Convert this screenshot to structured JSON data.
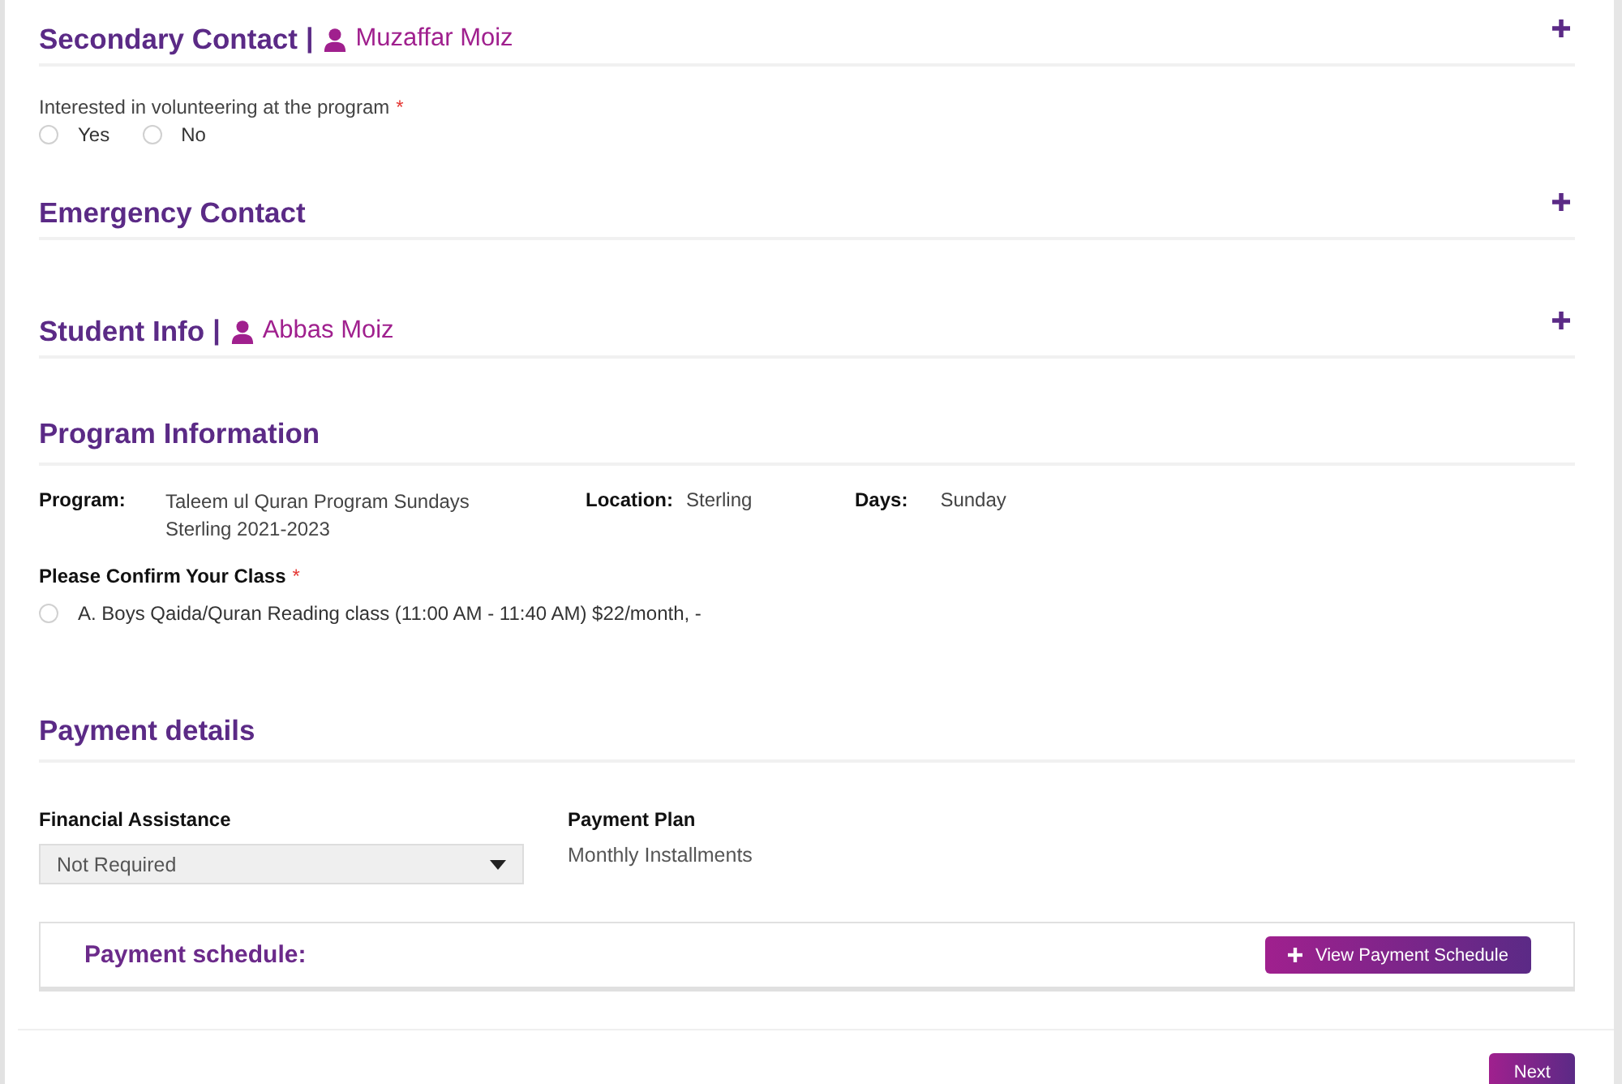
{
  "secondary_contact": {
    "title": "Secondary Contact",
    "separator": "|",
    "person": "Muzaffar Moiz",
    "expanded": false
  },
  "volunteer_question": {
    "label": "Interested in volunteering at the program",
    "required_mark": "*",
    "options": [
      {
        "label": "Yes",
        "selected": false
      },
      {
        "label": "No",
        "selected": false
      }
    ]
  },
  "emergency_contact": {
    "title": "Emergency Contact",
    "expanded": false
  },
  "student_info": {
    "title": "Student Info",
    "separator": "|",
    "person": "Abbas Moiz",
    "expanded": false
  },
  "program_information": {
    "title": "Program Information",
    "fields": [
      {
        "label": "Program:",
        "value": "Taleem ul Quran Program Sundays Sterling 2021-2023"
      },
      {
        "label": "Location:",
        "value": "Sterling"
      },
      {
        "label": "Days:",
        "value": "Sunday"
      }
    ],
    "class_question": {
      "label": "Please Confirm Your Class",
      "required_mark": "*",
      "options": [
        {
          "label": "A. Boys Qaida/Quran Reading class (11:00 AM - 11:40 AM) $22/month, -",
          "selected": false
        }
      ]
    }
  },
  "payment_details": {
    "title": "Payment details",
    "financial_assistance": {
      "label": "Financial Assistance",
      "value": "Not Required"
    },
    "payment_plan": {
      "label": "Payment Plan",
      "value": "Monthly Installments"
    },
    "payment_schedule": {
      "title": "Payment schedule:",
      "button": "View Payment Schedule"
    }
  },
  "next_button": "Next"
}
